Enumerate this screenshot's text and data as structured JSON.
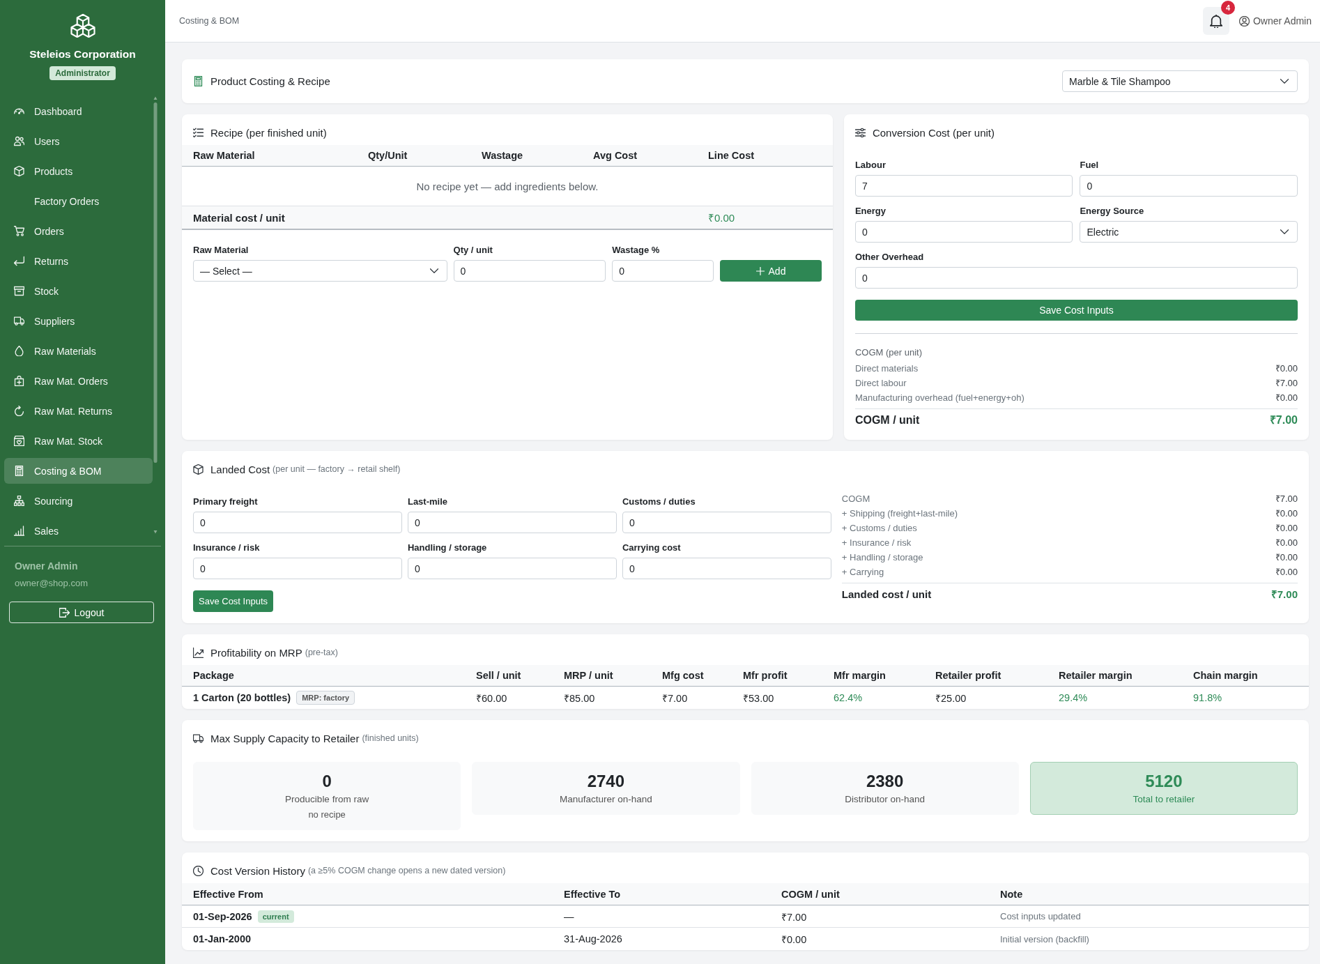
{
  "sidebar": {
    "brand": "Steleios Corporation",
    "role": "Administrator",
    "items": [
      {
        "label": "Dashboard",
        "selected": false
      },
      {
        "label": "Users",
        "selected": false
      },
      {
        "label": "Products",
        "selected": false
      },
      {
        "label": "Factory Orders",
        "selected": false
      },
      {
        "label": "Orders",
        "selected": false
      },
      {
        "label": "Returns",
        "selected": false
      },
      {
        "label": "Stock",
        "selected": false
      },
      {
        "label": "Suppliers",
        "selected": false
      },
      {
        "label": "Raw Materials",
        "selected": false
      },
      {
        "label": "Raw Mat. Orders",
        "selected": false
      },
      {
        "label": "Raw Mat. Returns",
        "selected": false
      },
      {
        "label": "Raw Mat. Stock",
        "selected": false
      },
      {
        "label": "Costing & BOM",
        "selected": true
      },
      {
        "label": "Sourcing",
        "selected": false
      },
      {
        "label": "Sales",
        "selected": false
      }
    ],
    "user": {
      "name": "Owner Admin",
      "email": "owner@shop.com"
    },
    "logout": "Logout"
  },
  "header": {
    "breadcrumb": "Costing & BOM",
    "notifications": "4",
    "user": "Owner Admin"
  },
  "product": {
    "title": "Product Costing & Recipe",
    "selected_product": "Marble & Tile Shampoo"
  },
  "recipe": {
    "title": "Recipe (per finished unit)",
    "columns": [
      "Raw Material",
      "Qty/Unit",
      "Wastage",
      "Avg Cost",
      "Line Cost"
    ],
    "empty_message": "No recipe yet — add ingredients below.",
    "total": {
      "label": "Material cost / unit",
      "value": "₹0.00"
    },
    "form": {
      "fields": [
        {
          "label": "Raw Material",
          "kind": "select",
          "value": "— Select —"
        },
        {
          "label": "Qty / unit",
          "kind": "input",
          "value": "0"
        },
        {
          "label": "Wastage %",
          "kind": "input",
          "value": "0"
        }
      ],
      "button": "Add"
    }
  },
  "conversion": {
    "title": "Conversion Cost (per unit)",
    "rows": [
      [
        {
          "label": "Labour",
          "kind": "input",
          "value": "7"
        },
        {
          "label": "Fuel",
          "kind": "input",
          "value": "0"
        }
      ],
      [
        {
          "label": "Energy",
          "kind": "input",
          "value": "0"
        },
        {
          "label": "Energy Source",
          "kind": "select",
          "value": "Electric"
        }
      ],
      [
        {
          "label": "Other Overhead",
          "kind": "input",
          "value": "0"
        }
      ]
    ],
    "button": "Save Cost Inputs",
    "summary": {
      "title": "COGM (per unit)",
      "lines": [
        {
          "label": "Direct materials",
          "value": "₹0.00"
        },
        {
          "label": "Direct labour",
          "value": "₹7.00"
        },
        {
          "label": "Manufacturing overhead (fuel+energy+oh)",
          "value": "₹0.00"
        }
      ],
      "total": {
        "label": "COGM / unit",
        "value": "₹7.00"
      }
    }
  },
  "landed": {
    "title": "Landed Cost",
    "subtitle": "(per unit — factory → retail shelf)",
    "fields": [
      {
        "label": "Primary freight",
        "value": "0"
      },
      {
        "label": "Last-mile",
        "value": "0"
      },
      {
        "label": "Customs / duties",
        "value": "0"
      },
      {
        "label": "Insurance / risk",
        "value": "0"
      },
      {
        "label": "Handling / storage",
        "value": "0"
      },
      {
        "label": "Carrying cost",
        "value": "0"
      }
    ],
    "button": "Save Cost Inputs",
    "lines": [
      {
        "label": "COGM",
        "value": "₹7.00"
      },
      {
        "label": "+ Shipping (freight+last-mile)",
        "value": "₹0.00"
      },
      {
        "label": "+ Customs / duties",
        "value": "₹0.00"
      },
      {
        "label": "+ Insurance / risk",
        "value": "₹0.00"
      },
      {
        "label": "+ Handling / storage",
        "value": "₹0.00"
      },
      {
        "label": "+ Carrying",
        "value": "₹0.00"
      }
    ],
    "total": {
      "label": "Landed cost / unit",
      "value": "₹7.00"
    }
  },
  "profitability": {
    "title": "Profitability on MRP",
    "subtitle": "(pre-tax)",
    "columns": [
      {
        "label": "Package",
        "kind": "package"
      },
      {
        "label": "Sell / unit",
        "kind": "money"
      },
      {
        "label": "MRP / unit",
        "kind": "money"
      },
      {
        "label": "Mfg cost",
        "kind": "money"
      },
      {
        "label": "Mfr profit",
        "kind": "money"
      },
      {
        "label": "Mfr margin",
        "kind": "percent"
      },
      {
        "label": "Retailer profit",
        "kind": "money"
      },
      {
        "label": "Retailer margin",
        "kind": "percent"
      },
      {
        "label": "Chain margin",
        "kind": "percent"
      }
    ],
    "rows": [
      {
        "cells": [
          "1 Carton (20 bottles)",
          "₹60.00",
          "₹85.00",
          "₹7.00",
          "₹53.00",
          "62.4%",
          "₹25.00",
          "29.4%",
          "91.8%"
        ],
        "badge": "MRP: factory"
      }
    ]
  },
  "supply": {
    "title": "Max Supply Capacity to Retailer",
    "subtitle": "(finished units)",
    "tiles": [
      {
        "value": "0",
        "label": "Producible from raw",
        "note": "no recipe",
        "highlighted": false
      },
      {
        "value": "2740",
        "label": "Manufacturer on-hand",
        "highlighted": false
      },
      {
        "value": "2380",
        "label": "Distributor on-hand",
        "highlighted": false
      },
      {
        "value": "5120",
        "label": "Total to retailer",
        "highlighted": true
      }
    ]
  },
  "history": {
    "title": "Cost Version History",
    "subtitle": "(a ≥5% COGM change opens a new dated version)",
    "columns": [
      "Effective From",
      "Effective To",
      "COGM / unit",
      "Note"
    ],
    "rows": [
      {
        "effective_from": "01-Sep-2026",
        "badge": "current",
        "effective_to": "—",
        "cogm": "₹7.00",
        "note": "Cost inputs updated"
      },
      {
        "effective_from": "01-Jan-2000",
        "effective_to": "31-Aug-2026",
        "cogm": "₹0.00",
        "note": "Initial version (backfill)"
      }
    ]
  }
}
